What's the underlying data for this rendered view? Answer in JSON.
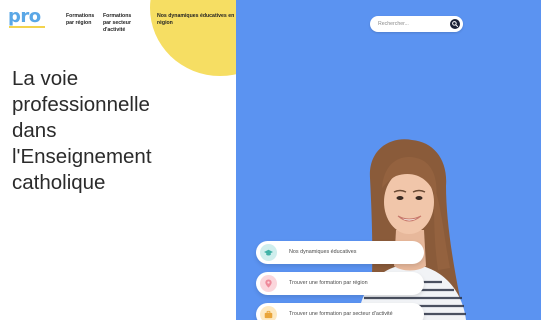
{
  "brand": {
    "logo_text": "pro"
  },
  "nav": {
    "items": [
      {
        "label": "Formations par région"
      },
      {
        "label": "Formations par secteur d'activité"
      },
      {
        "label": "Nos dynamiques éducatives en région"
      }
    ]
  },
  "hero": {
    "headline_lines": [
      "La voie",
      "professionnelle",
      "dans",
      "l'Enseignement",
      "catholique"
    ]
  },
  "search": {
    "placeholder": "Rechercher..."
  },
  "cards": [
    {
      "label": "Nos dynamiques éducatives",
      "icon": "graduation-cap-icon"
    },
    {
      "label": "Trouver une formation par région",
      "icon": "map-pin-icon"
    },
    {
      "label": "Trouver une formation par secteur d'activité",
      "icon": "briefcase-icon"
    }
  ],
  "colors": {
    "hero_blue": "#5b93f1",
    "accent_yellow": "#f6de63",
    "logo_teal": "#7ec9c1",
    "search_button": "#1b2136"
  }
}
